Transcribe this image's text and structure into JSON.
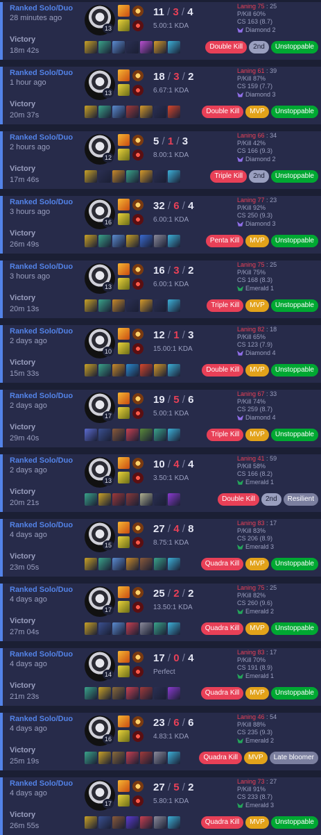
{
  "colors": {
    "accent": "#5383e8",
    "multi_kill": "#e84057",
    "mvp": "#e2a21a",
    "unstoppable": "#00a832",
    "diamond": "#8f6ee8",
    "emerald": "#24a65a"
  },
  "matches": [
    {
      "queue": "Ranked Solo/Duo",
      "time_ago": "28 minutes ago",
      "result": "Victory",
      "duration": "18m 42s",
      "champ_level": "13",
      "kills": "11",
      "deaths": "3",
      "assists": "4",
      "kda_ratio": "5.00:1 KDA",
      "laning": "Laning 75",
      "laning_opp": "25",
      "pkill": "P/Kill 60%",
      "cs": "CS 163 (8.7)",
      "tier": "Diamond 2",
      "tier_kind": "diamond",
      "badges": [
        {
          "label": "Double Kill",
          "kind": "red"
        },
        {
          "label": "2nd",
          "kind": "gray"
        },
        {
          "label": "Unstoppable",
          "kind": "green"
        }
      ],
      "items": [
        "#c9a227",
        "#3aa38a",
        "#5b8bd0",
        "#2a2f52",
        "#b84fd0",
        "#d59a2a",
        "#3cb0d8"
      ]
    },
    {
      "queue": "Ranked Solo/Duo",
      "time_ago": "1 hour ago",
      "result": "Victory",
      "duration": "20m 37s",
      "champ_level": "13",
      "kills": "18",
      "deaths": "3",
      "assists": "2",
      "kda_ratio": "6.67:1 KDA",
      "laning": "Laning 61",
      "laning_opp": "39",
      "pkill": "P/Kill 87%",
      "cs": "CS 159 (7.7)",
      "tier": "Diamond 3",
      "tier_kind": "diamond",
      "badges": [
        {
          "label": "Double Kill",
          "kind": "red"
        },
        {
          "label": "MVP",
          "kind": "gold"
        },
        {
          "label": "Unstoppable",
          "kind": "green"
        }
      ],
      "items": [
        "#c9a227",
        "#3aa38a",
        "#5b8bd0",
        "#a03a3a",
        "#d59a2a",
        "#2a2f52",
        "#d6462a"
      ]
    },
    {
      "queue": "Ranked Solo/Duo",
      "time_ago": "2 hours ago",
      "result": "Victory",
      "duration": "17m 46s",
      "champ_level": "12",
      "kills": "5",
      "deaths": "1",
      "assists": "3",
      "kda_ratio": "8.00:1 KDA",
      "laning": "Laning 66",
      "laning_opp": "34",
      "pkill": "P/Kill 42%",
      "cs": "CS 166 (9.3)",
      "tier": "Diamond 2",
      "tier_kind": "diamond",
      "badges": [
        {
          "label": "Triple Kill",
          "kind": "red"
        },
        {
          "label": "2nd",
          "kind": "gray"
        },
        {
          "label": "Unstoppable",
          "kind": "green"
        }
      ],
      "items": [
        "#c9a227",
        "#2a2f52",
        "#c88a2a",
        "#3aa38a",
        "#d59a2a",
        "#2a2f52",
        "#3cb0d8"
      ]
    },
    {
      "queue": "Ranked Solo/Duo",
      "time_ago": "3 hours ago",
      "result": "Victory",
      "duration": "26m 49s",
      "champ_level": "16",
      "kills": "32",
      "deaths": "6",
      "assists": "4",
      "kda_ratio": "6.00:1 KDA",
      "laning": "Laning 77",
      "laning_opp": "23",
      "pkill": "P/Kill 92%",
      "cs": "CS 250 (9.3)",
      "tier": "Diamond 3",
      "tier_kind": "diamond",
      "badges": [
        {
          "label": "Penta Kill",
          "kind": "red"
        },
        {
          "label": "MVP",
          "kind": "gold"
        },
        {
          "label": "Unstoppable",
          "kind": "green"
        }
      ],
      "items": [
        "#c9a227",
        "#3aa38a",
        "#5b8bd0",
        "#c9a227",
        "#3a6bd0",
        "#8a8a9a",
        "#3cb0d8"
      ]
    },
    {
      "queue": "Ranked Solo/Duo",
      "time_ago": "3 hours ago",
      "result": "Victory",
      "duration": "20m 13s",
      "champ_level": "13",
      "kills": "16",
      "deaths": "3",
      "assists": "2",
      "kda_ratio": "6.00:1 KDA",
      "laning": "Laning 75",
      "laning_opp": "25",
      "pkill": "P/Kill 75%",
      "cs": "CS 168 (8.3)",
      "tier": "Emerald 1",
      "tier_kind": "emerald",
      "badges": [
        {
          "label": "Triple Kill",
          "kind": "red"
        },
        {
          "label": "MVP",
          "kind": "gold"
        },
        {
          "label": "Unstoppable",
          "kind": "green"
        }
      ],
      "items": [
        "#c9a227",
        "#3aa38a",
        "#c88a2a",
        "#2a2f52",
        "#d59a2a",
        "#2a2f52",
        "#3cb0d8"
      ]
    },
    {
      "queue": "Ranked Solo/Duo",
      "time_ago": "2 days ago",
      "result": "Victory",
      "duration": "15m 33s",
      "champ_level": "10",
      "kills": "12",
      "deaths": "1",
      "assists": "3",
      "kda_ratio": "15.00:1 KDA",
      "laning": "Laning 82",
      "laning_opp": "18",
      "pkill": "P/Kill 65%",
      "cs": "CS 123 (7.9)",
      "tier": "Diamond 4",
      "tier_kind": "diamond",
      "badges": [
        {
          "label": "Double Kill",
          "kind": "red"
        },
        {
          "label": "MVP",
          "kind": "gold"
        },
        {
          "label": "Unstoppable",
          "kind": "green"
        }
      ],
      "items": [
        "#c9a227",
        "#3aa38a",
        "#c88a2a",
        "#2a8ad0",
        "#d6462a",
        "#d59a2a",
        "#3cb0d8"
      ]
    },
    {
      "queue": "Ranked Solo/Duo",
      "time_ago": "2 days ago",
      "result": "Victory",
      "duration": "29m 40s",
      "champ_level": "17",
      "kills": "19",
      "deaths": "5",
      "assists": "6",
      "kda_ratio": "5.00:1 KDA",
      "laning": "Laning 67",
      "laning_opp": "33",
      "pkill": "P/Kill 74%",
      "cs": "CS 259 (8.7)",
      "tier": "Diamond 4",
      "tier_kind": "diamond",
      "badges": [
        {
          "label": "Triple Kill",
          "kind": "red"
        },
        {
          "label": "MVP",
          "kind": "gold"
        },
        {
          "label": "Unstoppable",
          "kind": "green"
        }
      ],
      "items": [
        "#5b6bd0",
        "#3a5090",
        "#8a5a3a",
        "#c84050",
        "#5a8a3a",
        "#3aa38a",
        "#3cb0d8"
      ]
    },
    {
      "queue": "Ranked Solo/Duo",
      "time_ago": "2 days ago",
      "result": "Victory",
      "duration": "20m 21s",
      "champ_level": "13",
      "kills": "10",
      "deaths": "4",
      "assists": "4",
      "kda_ratio": "3.50:1 KDA",
      "laning": "Laning 41",
      "laning_opp": "59",
      "pkill": "P/Kill 58%",
      "cs": "CS 166 (8.2)",
      "tier": "Emerald 1",
      "tier_kind": "emerald",
      "badges": [
        {
          "label": "Double Kill",
          "kind": "red"
        },
        {
          "label": "2nd",
          "kind": "gray"
        },
        {
          "label": "Resilient",
          "kind": "slate"
        }
      ],
      "items": [
        "#3aa38a",
        "#c9a227",
        "#a03a3a",
        "#8a3a3a",
        "#b0b090",
        "#2a2f52",
        "#8a3ad0"
      ]
    },
    {
      "queue": "Ranked Solo/Duo",
      "time_ago": "4 days ago",
      "result": "Victory",
      "duration": "23m 05s",
      "champ_level": "15",
      "kills": "27",
      "deaths": "4",
      "assists": "8",
      "kda_ratio": "8.75:1 KDA",
      "laning": "Laning 83",
      "laning_opp": "17",
      "pkill": "P/Kill 83%",
      "cs": "CS 206 (8.9)",
      "tier": "Emerald 3",
      "tier_kind": "emerald",
      "badges": [
        {
          "label": "Quadra Kill",
          "kind": "red"
        },
        {
          "label": "MVP",
          "kind": "gold"
        },
        {
          "label": "Unstoppable",
          "kind": "green"
        }
      ],
      "items": [
        "#c9a227",
        "#3aa38a",
        "#5b8bd0",
        "#c88a2a",
        "#8a5a3a",
        "#3aa38a",
        "#3cb0d8"
      ]
    },
    {
      "queue": "Ranked Solo/Duo",
      "time_ago": "4 days ago",
      "result": "Victory",
      "duration": "27m 04s",
      "champ_level": "17",
      "kills": "25",
      "deaths": "2",
      "assists": "2",
      "kda_ratio": "13.50:1 KDA",
      "laning": "Laning 75",
      "laning_opp": "25",
      "pkill": "P/Kill 82%",
      "cs": "CS 260 (9.6)",
      "tier": "Emerald 2",
      "tier_kind": "emerald",
      "badges": [
        {
          "label": "Quadra Kill",
          "kind": "red"
        },
        {
          "label": "MVP",
          "kind": "gold"
        },
        {
          "label": "Unstoppable",
          "kind": "green"
        }
      ],
      "items": [
        "#c9a227",
        "#3a5090",
        "#5b8bd0",
        "#c84050",
        "#8a8a9a",
        "#3aa38a",
        "#3cb0d8"
      ]
    },
    {
      "queue": "Ranked Solo/Duo",
      "time_ago": "4 days ago",
      "result": "Victory",
      "duration": "21m 23s",
      "champ_level": "14",
      "kills": "17",
      "deaths": "0",
      "assists": "4",
      "kda_ratio": "Perfect",
      "laning": "Laning 83",
      "laning_opp": "17",
      "pkill": "P/Kill 70%",
      "cs": "CS 191 (8.9)",
      "tier": "Emerald 1",
      "tier_kind": "emerald",
      "badges": [
        {
          "label": "Quadra Kill",
          "kind": "red"
        },
        {
          "label": "MVP",
          "kind": "gold"
        },
        {
          "label": "Unstoppable",
          "kind": "green"
        }
      ],
      "items": [
        "#3aa38a",
        "#c9a227",
        "#8a6a3a",
        "#c84050",
        "#a03a3a",
        "#2a2f52",
        "#8a3ad0"
      ]
    },
    {
      "queue": "Ranked Solo/Duo",
      "time_ago": "4 days ago",
      "result": "Victory",
      "duration": "25m 19s",
      "champ_level": "16",
      "kills": "23",
      "deaths": "6",
      "assists": "6",
      "kda_ratio": "4.83:1 KDA",
      "laning": "Laning 46",
      "laning_opp": "54",
      "pkill": "P/Kill 88%",
      "cs": "CS 235 (9.3)",
      "tier": "Emerald 2",
      "tier_kind": "emerald",
      "badges": [
        {
          "label": "Quadra Kill",
          "kind": "red"
        },
        {
          "label": "MVP",
          "kind": "gold"
        },
        {
          "label": "Late bloomer",
          "kind": "slate"
        }
      ],
      "items": [
        "#3aa38a",
        "#c9a227",
        "#8a6a3a",
        "#c84050",
        "#a03a3a",
        "#8a8a9a",
        "#3cb0d8"
      ]
    },
    {
      "queue": "Ranked Solo/Duo",
      "time_ago": "4 days ago",
      "result": "Victory",
      "duration": "26m 55s",
      "champ_level": "17",
      "kills": "27",
      "deaths": "5",
      "assists": "2",
      "kda_ratio": "5.80:1 KDA",
      "laning": "Laning 73",
      "laning_opp": "27",
      "pkill": "P/Kill 91%",
      "cs": "CS 233 (8.7)",
      "tier": "Emerald 3",
      "tier_kind": "emerald",
      "badges": [
        {
          "label": "Quadra Kill",
          "kind": "red"
        },
        {
          "label": "MVP",
          "kind": "gold"
        },
        {
          "label": "Unstoppable",
          "kind": "green"
        }
      ],
      "items": [
        "#c9a227",
        "#3a5090",
        "#8a5a3a",
        "#5b3ad0",
        "#c84050",
        "#8a8a9a",
        "#3cb0d8"
      ]
    }
  ]
}
